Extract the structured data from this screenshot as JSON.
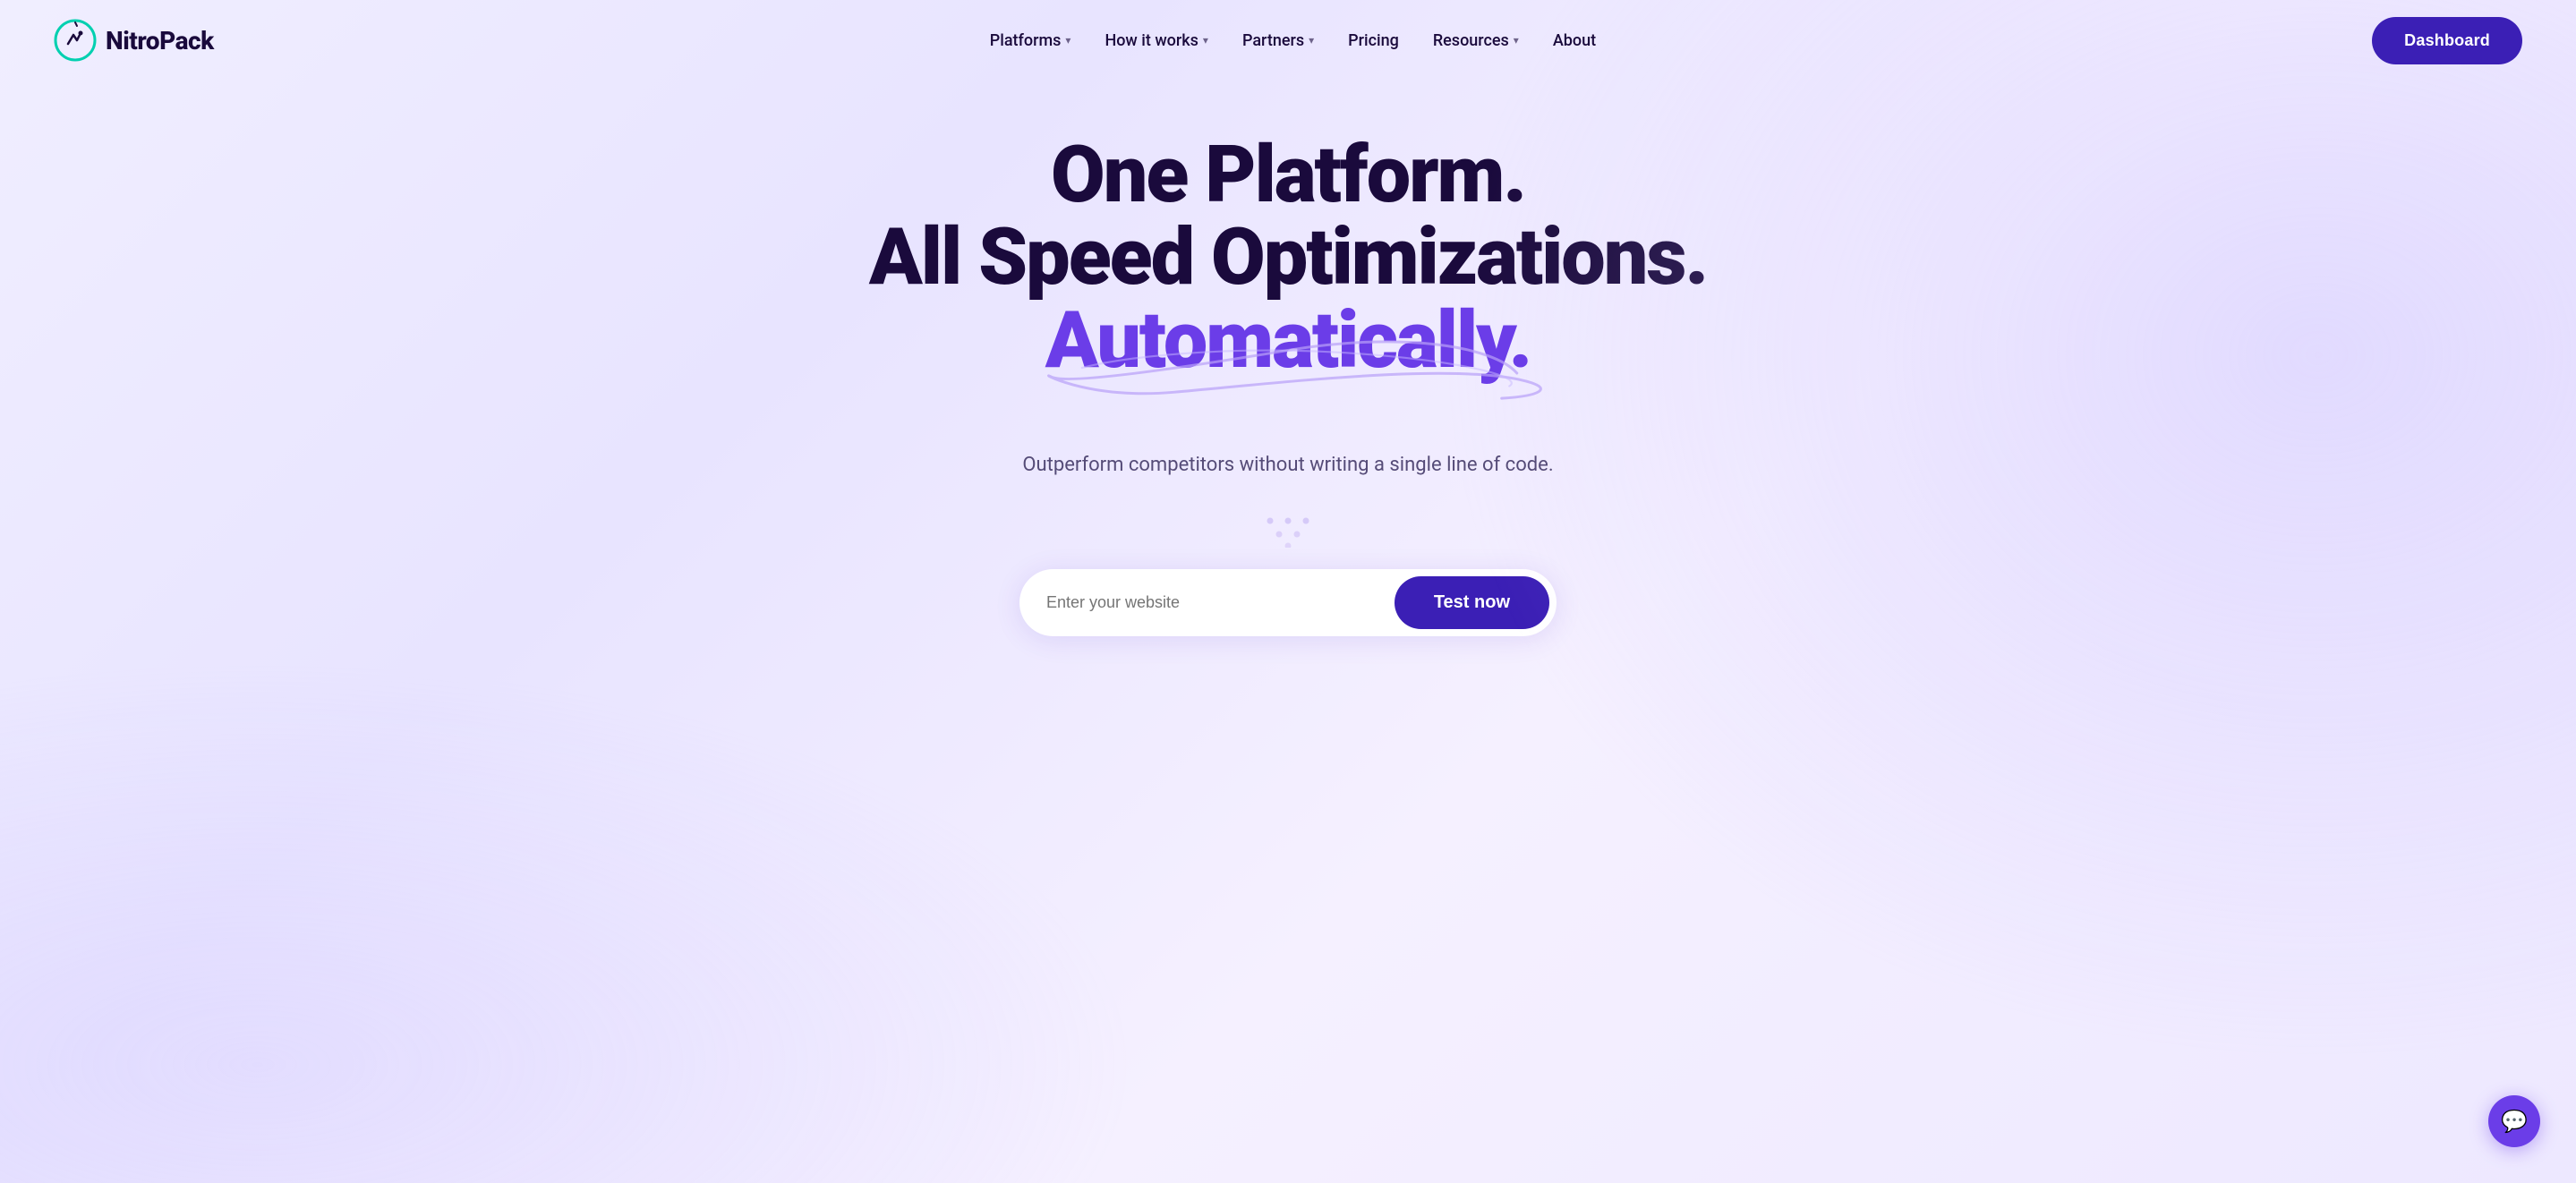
{
  "logo": {
    "text": "NitroPack",
    "aria": "NitroPack home"
  },
  "nav": {
    "links": [
      {
        "label": "Platforms",
        "hasDropdown": true,
        "name": "platforms"
      },
      {
        "label": "How it works",
        "hasDropdown": true,
        "name": "how-it-works"
      },
      {
        "label": "Partners",
        "hasDropdown": true,
        "name": "partners"
      },
      {
        "label": "Pricing",
        "hasDropdown": false,
        "name": "pricing"
      },
      {
        "label": "Resources",
        "hasDropdown": true,
        "name": "resources"
      },
      {
        "label": "About",
        "hasDropdown": false,
        "name": "about"
      }
    ],
    "dashboard_label": "Dashboard"
  },
  "hero": {
    "line1": "One Platform.",
    "line2": "All Speed Optimizations.",
    "line3": "Automatically.",
    "subtitle": "Outperform competitors without writing a single line of code.",
    "cta_placeholder": "Enter your website",
    "cta_button": "Test now"
  },
  "chat": {
    "aria": "Open chat"
  },
  "colors": {
    "brand_dark": "#1a0a3c",
    "brand_purple": "#3b1fb5",
    "accent_purple": "#6b3de8"
  }
}
